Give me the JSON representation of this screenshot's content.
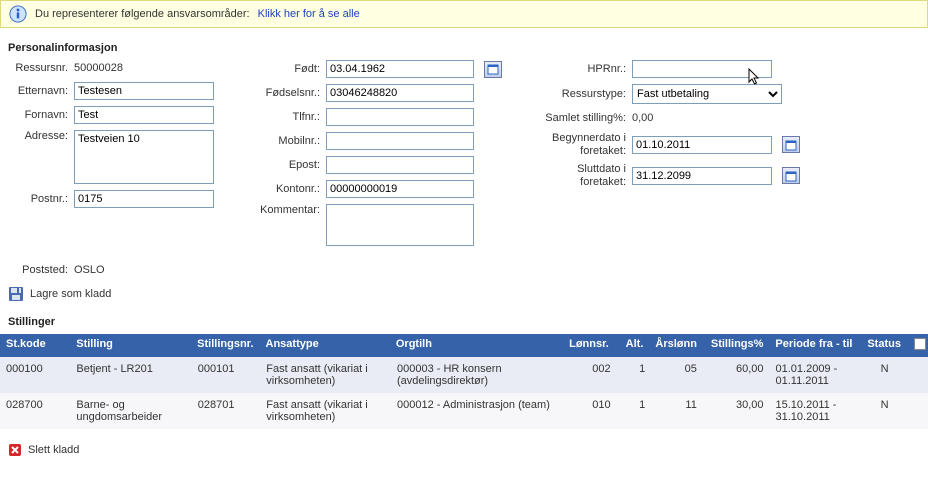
{
  "banner": {
    "prefix": "Du representerer følgende ansvarsområder:",
    "link": "Klikk her for å se alle"
  },
  "section1_title": "Personalinformasjon",
  "col1": {
    "ressursnr_lbl": "Ressursnr.",
    "ressursnr_val": "50000028",
    "etternavn_lbl": "Etternavn:",
    "etternavn_val": "Testesen",
    "fornavn_lbl": "Fornavn:",
    "fornavn_val": "Test",
    "adresse_lbl": "Adresse:",
    "adresse_val": "Testveien 10",
    "postnr_lbl": "Postnr.:",
    "postnr_val": "0175",
    "poststed_lbl": "Poststed:",
    "poststed_val": "OSLO"
  },
  "col2": {
    "fodt_lbl": "Født:",
    "fodt_val": "03.04.1962",
    "fodselsnr_lbl": "Fødselsnr.:",
    "fodselsnr_val": "03046248820",
    "tlfnr_lbl": "Tlfnr.:",
    "tlfnr_val": "",
    "mobilnr_lbl": "Mobilnr.:",
    "mobilnr_val": "",
    "epost_lbl": "Epost:",
    "epost_val": "",
    "kontonr_lbl": "Kontonr.:",
    "kontonr_val": "00000000019",
    "kommentar_lbl": "Kommentar:",
    "kommentar_val": ""
  },
  "col3": {
    "hprnr_lbl": "HPRnr.:",
    "hprnr_val": "",
    "ressurstype_lbl": "Ressurstype:",
    "ressurstype_val": "Fast utbetaling",
    "samlet_lbl": "Samlet stilling%:",
    "samlet_val": "0,00",
    "begynnerdato_lbl": "Begynnerdato i foretaket:",
    "begynnerdato_val": "01.10.2011",
    "sluttdato_lbl": "Sluttdato i foretaket:",
    "sluttdato_val": "31.12.2099"
  },
  "save_label": "Lagre som kladd",
  "section2_title": "Stillinger",
  "grid": {
    "headers": {
      "stcode": "St.kode",
      "stilling": "Stilling",
      "stnr": "Stillingsnr.",
      "atype": "Ansattype",
      "org": "Orgtilh",
      "lonn": "Lønnsr.",
      "alt": "Alt.",
      "arslonn": "Årslønn",
      "pct": "Stillings%",
      "per": "Periode fra - til",
      "status": "Status"
    },
    "rows": [
      {
        "stcode": "000100",
        "stilling": "Betjent - LR201",
        "stnr": "000101",
        "atype": "Fast ansatt (vikariat i virksomheten)",
        "org": "000003 - HR konsern (avdelingsdirektør)",
        "lonn": "002",
        "alt": "1",
        "arslonn": "05",
        "pct": "60,00",
        "per": "01.01.2009 - 01.11.2011",
        "status": "N"
      },
      {
        "stcode": "028700",
        "stilling": "Barne- og ungdomsarbeider",
        "stnr": "028701",
        "atype": "Fast ansatt (vikariat i virksomheten)",
        "org": "000012 - Administrasjon (team)",
        "lonn": "010",
        "alt": "1",
        "arslonn": "11",
        "pct": "30,00",
        "per": "15.10.2011 - 31.10.2011",
        "status": "N"
      }
    ]
  },
  "delete_label": "Slett kladd"
}
